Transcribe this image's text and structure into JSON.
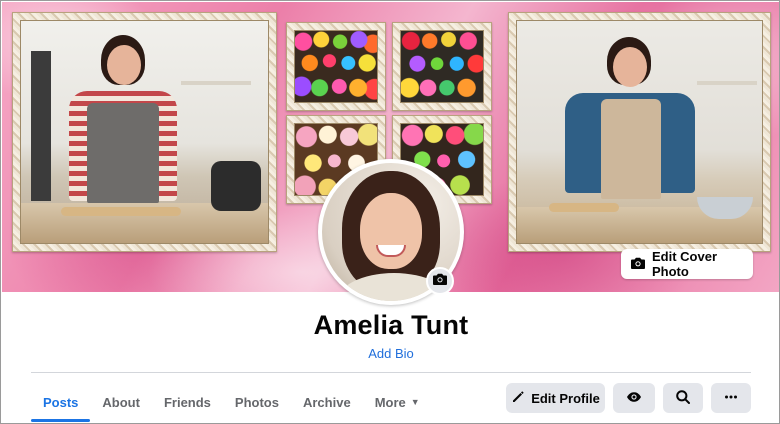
{
  "profile": {
    "name": "Amelia Tunt",
    "add_bio": "Add Bio"
  },
  "cover": {
    "edit_cover_label": "Edit Cover Photo",
    "icons": {
      "cover_camera": "camera-icon",
      "avatar_camera": "camera-icon"
    }
  },
  "tabs": [
    {
      "label": "Posts",
      "active": true
    },
    {
      "label": "About",
      "active": false
    },
    {
      "label": "Friends",
      "active": false
    },
    {
      "label": "Photos",
      "active": false
    },
    {
      "label": "Archive",
      "active": false
    },
    {
      "label": "More",
      "active": false
    }
  ],
  "actions": {
    "edit_profile_label": "Edit Profile",
    "icons": {
      "edit": "pencil-icon",
      "view_as": "eye-icon",
      "search": "search-icon",
      "more": "more-dots-icon",
      "more_tab": "caret-down-icon"
    }
  },
  "colors": {
    "accent": "#1b74e4",
    "link": "#216fdb",
    "button_bg": "#e4e6eb",
    "cover_pink": "#ec7fa9"
  }
}
